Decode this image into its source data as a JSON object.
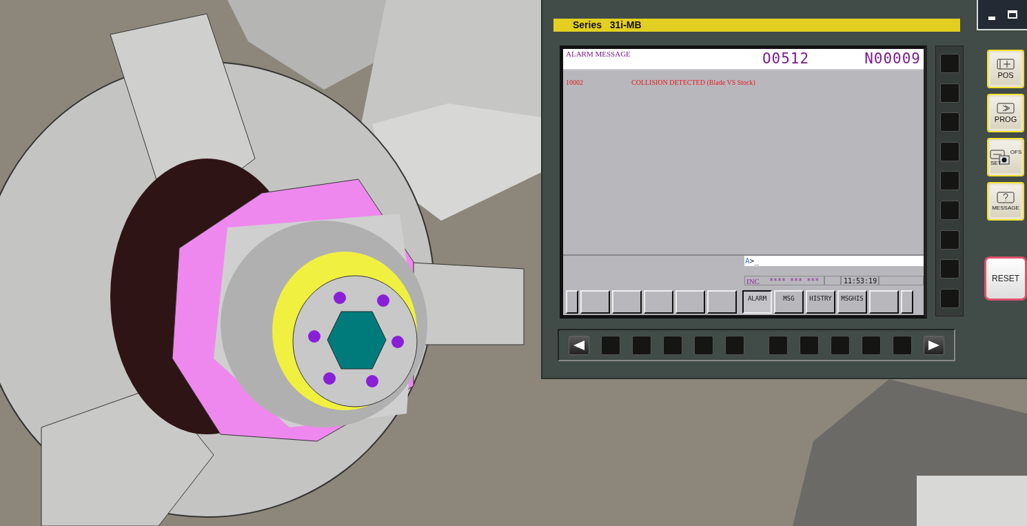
{
  "panel": {
    "series_label": "Series   31i-MB"
  },
  "screen": {
    "title": "ALARM MESSAGE",
    "program_number": "O0512",
    "sequence_number": "N00009",
    "alarms": [
      {
        "code": "10002",
        "message": "COLLISION DETECTED (Blade VS Stock)"
      }
    ],
    "input_line": {
      "prompt": "A",
      "text": ">_"
    },
    "status": {
      "mode": "INC",
      "marks": "**** *** ***",
      "time": "11:53:19"
    }
  },
  "softkeys": [
    {
      "label": "ALARM",
      "selected": true
    },
    {
      "label": "MSG",
      "selected": false
    },
    {
      "label": "HISTRY",
      "selected": false
    },
    {
      "label": "MSGHIS",
      "selected": false
    }
  ],
  "function_keys": [
    {
      "kind": "pos",
      "label": "POS"
    },
    {
      "kind": "prog",
      "label": "PROG"
    },
    {
      "kind": "ofs",
      "label": "OFS",
      "sublabel": "SET"
    },
    {
      "kind": "message",
      "label": "MESSAGE"
    }
  ],
  "reset_key": {
    "label": "RESET"
  }
}
